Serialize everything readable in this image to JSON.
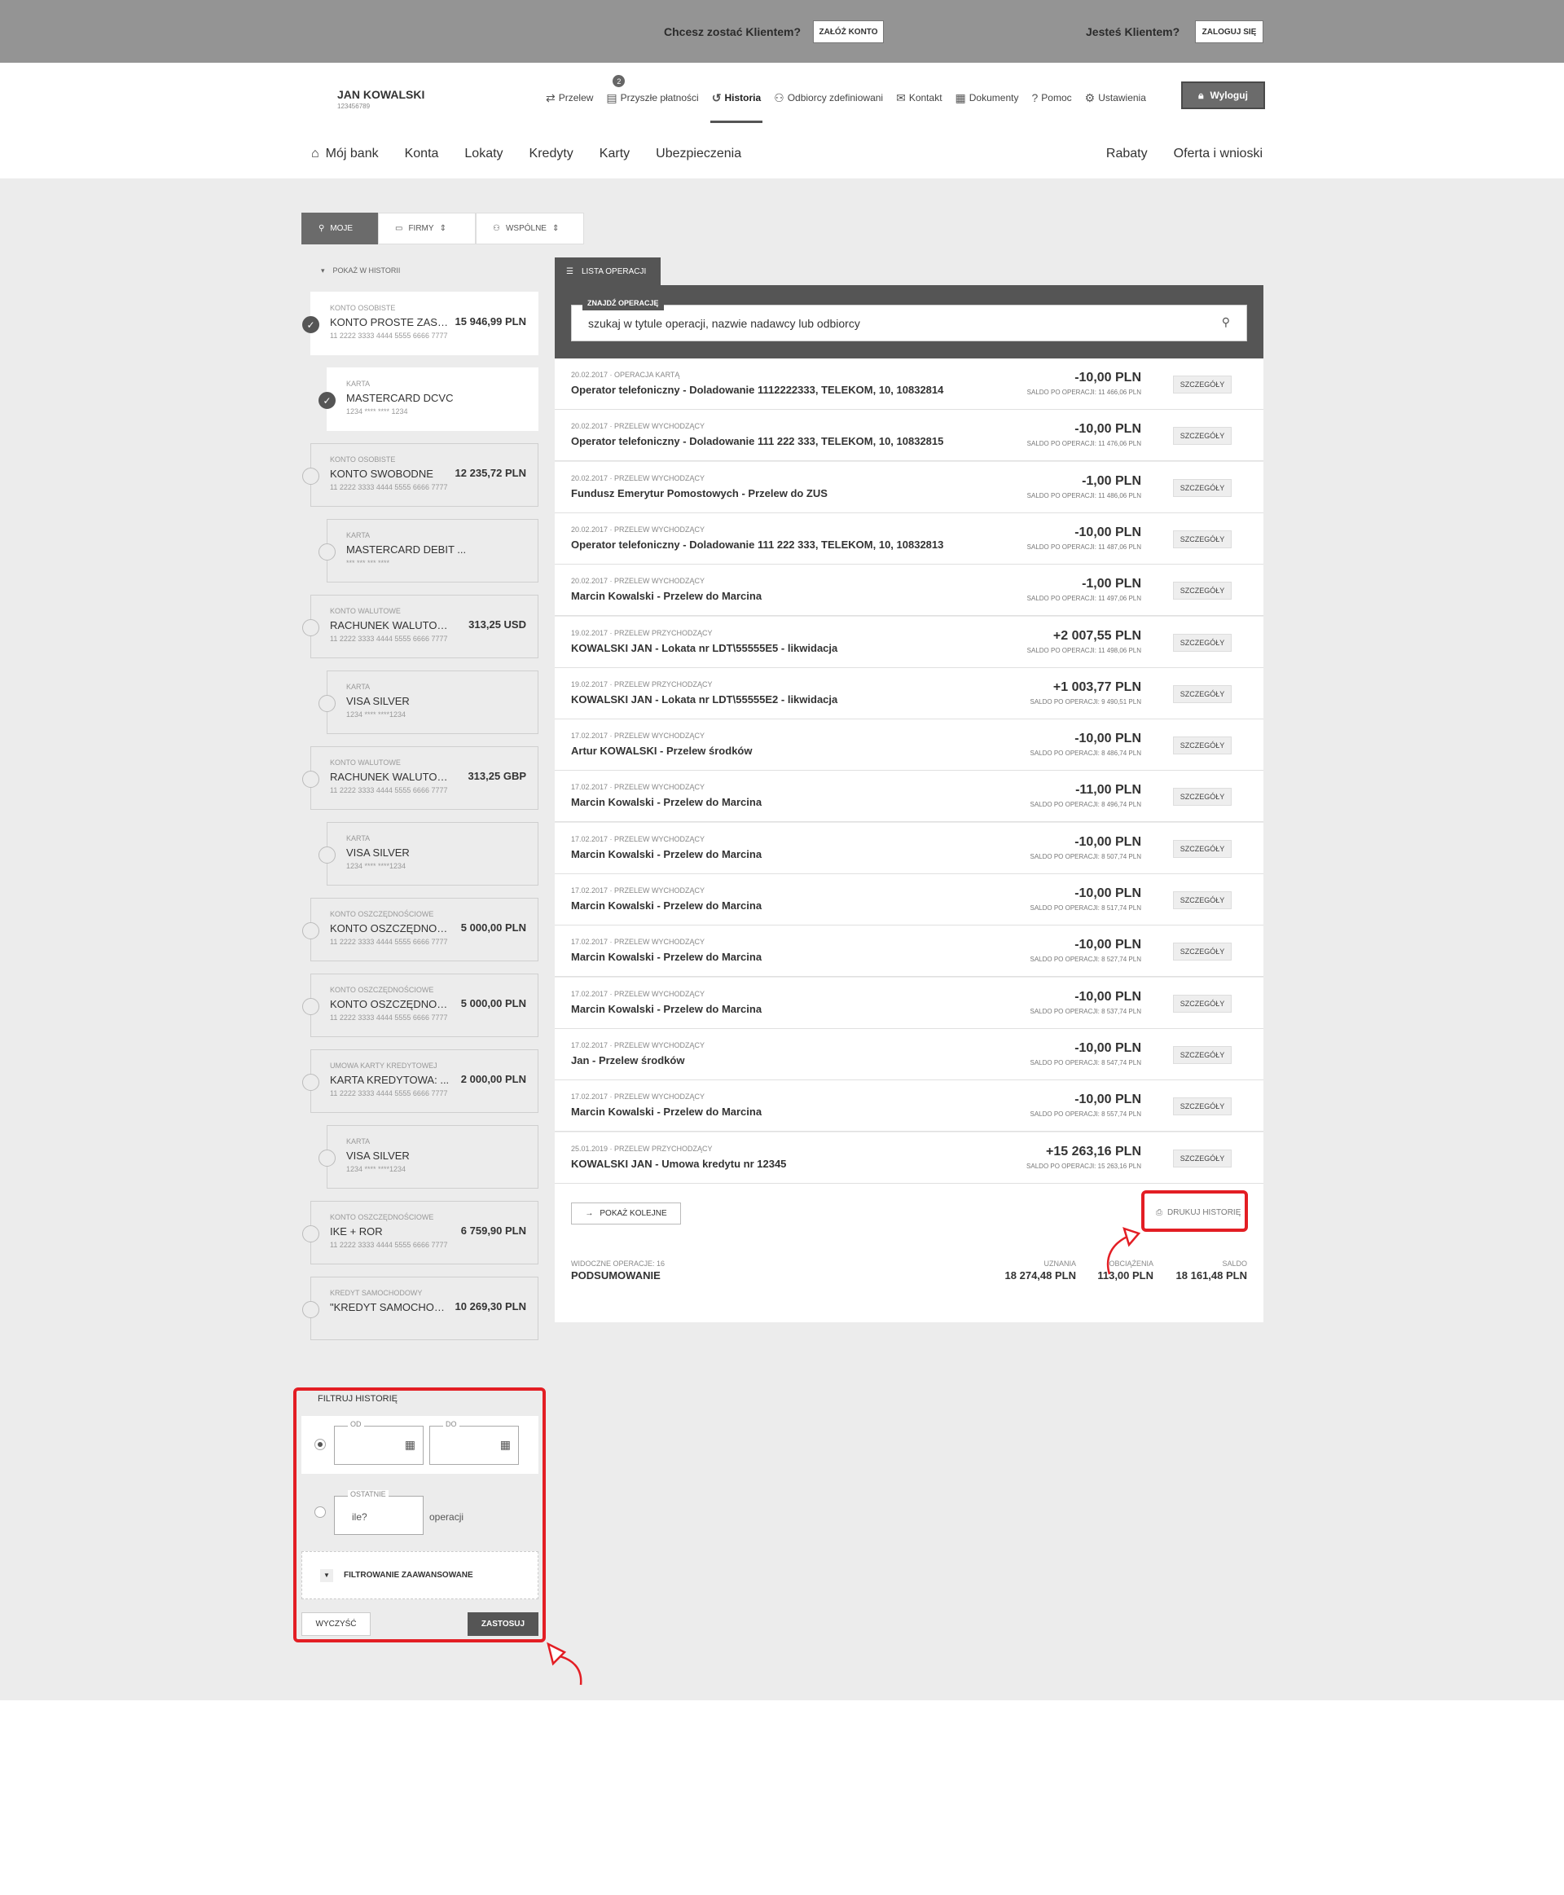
{
  "top_band": {
    "prospect_question": "Chcesz zostać Klientem?",
    "open_account_button": "ZAŁÓŻ KONTO",
    "client_question": "Jesteś Klientem?",
    "login_button": "ZALOGUJ SIĘ"
  },
  "user": {
    "name": "JAN KOWALSKI",
    "id": "123456789"
  },
  "top_nav": {
    "transfer": "Przelew",
    "future_payments": "Przyszłe płatności",
    "future_payments_badge": "2",
    "history": "Historia",
    "recipients": "Odbiorcy zdefiniowani",
    "contact": "Kontakt",
    "documents": "Dokumenty",
    "help": "Pomoc",
    "settings": "Ustawienia",
    "logout": "Wyloguj"
  },
  "main_nav": {
    "my_bank": "Mój bank",
    "accounts": "Konta",
    "deposits": "Lokaty",
    "credits": "Kredyty",
    "cards": "Karty",
    "insurance": "Ubezpieczenia",
    "discounts": "Rabaty",
    "offer": "Oferta i wnioski"
  },
  "segments": {
    "mine": "MOJE",
    "firms": "FIRMY",
    "shared": "WSPÓLNE"
  },
  "show_in_history": "POKAŻ W HISTORII",
  "accounts": [
    {
      "type": "KONTO OSOBISTE",
      "name": "KONTO PROSTE ZASADY",
      "balance": "15 946,99 PLN",
      "number": "11 2222 3333 4444 5555 6666 7777",
      "selected": true
    },
    {
      "type": "KARTA",
      "name": "MASTERCARD DCVC",
      "balance": "",
      "number": "1234 **** **** 1234",
      "selected": true
    },
    {
      "type": "KONTO OSOBISTE",
      "name": "KONTO SWOBODNE",
      "balance": "12 235,72 PLN",
      "number": "11 2222 3333 4444 5555 6666 7777",
      "selected": false
    },
    {
      "type": "KARTA",
      "name": "MASTERCARD DEBIT ...",
      "balance": "",
      "number": "*** *** *** ****",
      "selected": false
    },
    {
      "type": "KONTO WALUTOWE",
      "name": "RACHUNEK WALUTOWY",
      "balance": "313,25 USD",
      "number": "11 2222 3333 4444 5555 6666 7777",
      "selected": false
    },
    {
      "type": "KARTA",
      "name": "VISA SILVER",
      "balance": "",
      "number": "1234 **** ****1234",
      "selected": false
    },
    {
      "type": "KONTO WALUTOWE",
      "name": "RACHUNEK WALUTOWY",
      "balance": "313,25 GBP",
      "number": "11 2222 3333 4444 5555 6666 7777",
      "selected": false
    },
    {
      "type": "KARTA",
      "name": "VISA SILVER",
      "balance": "",
      "number": "1234 **** ****1234",
      "selected": false
    },
    {
      "type": "KONTO OSZCZĘDNOŚCIOWE",
      "name": "KONTO OSZCZĘDNOŚCIOWE",
      "balance": "5 000,00 PLN",
      "number": "11 2222 3333 4444 5555 6666 7777",
      "selected": false
    },
    {
      "type": "KONTO OSZCZĘDNOŚCIOWE",
      "name": "KONTO OSZCZĘDNOŚCIOWE",
      "balance": "5 000,00 PLN",
      "number": "11 2222 3333 4444 5555 6666 7777",
      "selected": false
    },
    {
      "type": "UMOWA KARTY KREDYTOWEJ",
      "name": "KARTA KREDYTOWA: ...",
      "balance": "2 000,00 PLN",
      "number": "11 2222 3333 4444 5555 6666 7777",
      "selected": false
    },
    {
      "type": "KARTA",
      "name": "VISA SILVER",
      "balance": "",
      "number": "1234 **** ****1234",
      "selected": false
    },
    {
      "type": "KONTO OSZCZĘDNOŚCIOWE",
      "name": "IKE + ROR",
      "balance": "6 759,90 PLN",
      "number": "11 2222 3333 4444 5555 6666 7777",
      "selected": false
    },
    {
      "type": "KREDYT SAMOCHODOWY",
      "name": "\"KREDYT SAMOCHODOWY\"",
      "balance": "10 269,30 PLN",
      "number": "",
      "selected": false
    }
  ],
  "operations": {
    "tab_label": "LISTA OPERACJI",
    "search_label": "ZNAJDŹ OPERACJĘ",
    "search_placeholder": "szukaj w tytule operacji, nazwie nadawcy lub odbiorcy",
    "details_label": "SZCZEGÓŁY",
    "items": [
      {
        "meta": "20.02.2017 · OPERACJA KARTĄ",
        "title": "Operator telefoniczny - Doladowanie 1112222333, TELEKOM, 10, 10832814",
        "amount": "-10,00 PLN",
        "balance_after": "SALDO PO OPERACJI: 11 466,06 PLN"
      },
      {
        "meta": "20.02.2017 · PRZELEW WYCHODZĄCY",
        "title": "Operator telefoniczny - Doladowanie 111 222 333, TELEKOM, 10, 10832815",
        "amount": "-10,00 PLN",
        "balance_after": "SALDO PO OPERACJI: 11 476,06 PLN"
      },
      {
        "meta": "20.02.2017 · PRZELEW WYCHODZĄCY",
        "title": "Fundusz Emerytur Pomostowych - Przelew do ZUS",
        "amount": "-1,00 PLN",
        "balance_after": "SALDO PO OPERACJI: 11 486,06 PLN"
      },
      {
        "meta": "20.02.2017 · PRZELEW WYCHODZĄCY",
        "title": "Operator telefoniczny - Doladowanie 111 222 333, TELEKOM, 10, 10832813",
        "amount": "-10,00 PLN",
        "balance_after": "SALDO PO OPERACJI: 11 487,06 PLN"
      },
      {
        "meta": "20.02.2017 · PRZELEW WYCHODZĄCY",
        "title": "Marcin Kowalski - Przelew do Marcina",
        "amount": "-1,00 PLN",
        "balance_after": "SALDO PO OPERACJI: 11 497,06 PLN"
      },
      {
        "meta": "19.02.2017 · PRZELEW PRZYCHODZĄCY",
        "title": "KOWALSKI JAN - Lokata nr LDT\\55555E5 - likwidacja",
        "amount": "+2 007,55 PLN",
        "balance_after": "SALDO PO OPERACJI: 11 498,06 PLN"
      },
      {
        "meta": "19.02.2017 · PRZELEW PRZYCHODZĄCY",
        "title": "KOWALSKI JAN - Lokata nr LDT\\55555E2 - likwidacja",
        "amount": "+1 003,77 PLN",
        "balance_after": "SALDO PO OPERACJI: 9 490,51 PLN"
      },
      {
        "meta": "17.02.2017 · PRZELEW WYCHODZĄCY",
        "title": "Artur KOWALSKI - Przelew środków",
        "amount": "-10,00 PLN",
        "balance_after": "SALDO PO OPERACJI: 8 486,74 PLN"
      },
      {
        "meta": "17.02.2017 · PRZELEW WYCHODZĄCY",
        "title": "Marcin Kowalski - Przelew do Marcina",
        "amount": "-11,00 PLN",
        "balance_after": "SALDO PO OPERACJI: 8 496,74 PLN"
      },
      {
        "meta": "17.02.2017 · PRZELEW WYCHODZĄCY",
        "title": "Marcin Kowalski - Przelew do Marcina",
        "amount": "-10,00 PLN",
        "balance_after": "SALDO PO OPERACJI: 8 507,74 PLN"
      },
      {
        "meta": "17.02.2017 · PRZELEW WYCHODZĄCY",
        "title": "Marcin Kowalski - Przelew do Marcina",
        "amount": "-10,00 PLN",
        "balance_after": "SALDO PO OPERACJI: 8 517,74 PLN"
      },
      {
        "meta": "17.02.2017 · PRZELEW WYCHODZĄCY",
        "title": "Marcin Kowalski - Przelew do Marcina",
        "amount": "-10,00 PLN",
        "balance_after": "SALDO PO OPERACJI: 8 527,74 PLN"
      },
      {
        "meta": "17.02.2017 · PRZELEW WYCHODZĄCY",
        "title": "Marcin Kowalski - Przelew do Marcina",
        "amount": "-10,00 PLN",
        "balance_after": "SALDO PO OPERACJI: 8 537,74 PLN"
      },
      {
        "meta": "17.02.2017 · PRZELEW WYCHODZĄCY",
        "title": "Jan - Przelew środków",
        "amount": "-10,00 PLN",
        "balance_after": "SALDO PO OPERACJI: 8 547,74 PLN"
      },
      {
        "meta": "17.02.2017 · PRZELEW WYCHODZĄCY",
        "title": "Marcin Kowalski - Przelew do Marcina",
        "amount": "-10,00 PLN",
        "balance_after": "SALDO PO OPERACJI: 8 557,74 PLN"
      },
      {
        "meta": "25.01.2019 · PRZELEW PRZYCHODZĄCY",
        "title": "KOWALSKI JAN - Umowa kredytu nr 12345",
        "amount": "+15 263,16 PLN",
        "balance_after": "SALDO PO OPERACJI: 15 263,16 PLN"
      }
    ],
    "show_more": "POKAŻ KOLEJNE",
    "print_history": "DRUKUJ HISTORIĘ"
  },
  "summary": {
    "visible_ops": "WIDOCZNE OPERACJE: 16",
    "label": "PODSUMOWANIE",
    "credits_label": "UZNANIA",
    "credits": "18 274,48 PLN",
    "debits_label": "OBCIĄŻENIA",
    "debits": "113,00 PLN",
    "balance_label": "SALDO",
    "balance": "18 161,48 PLN"
  },
  "filter": {
    "title": "FILTRUJ HISTORIĘ",
    "from_label": "OD",
    "to_label": "DO",
    "last_label": "OSTATNIE",
    "last_placeholder": "ile?",
    "operations_suffix": "operacji",
    "advanced": "FILTROWANIE ZAAWANSOWANE",
    "clear": "WYCZYŚĆ",
    "apply": "ZASTOSUJ"
  },
  "colors": {
    "highlight": "#e31e24",
    "dark": "#555555",
    "panel_bg": "#ececec"
  }
}
